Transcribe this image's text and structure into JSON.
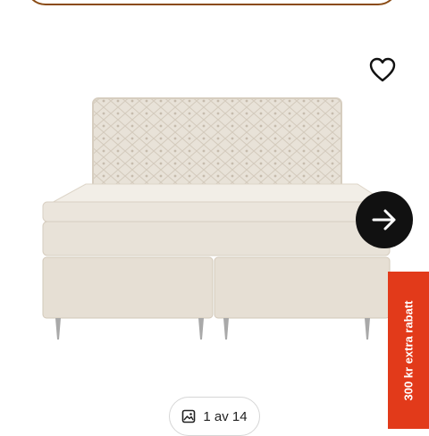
{
  "gallery": {
    "counter_text": "1 av 14",
    "icon_gallery": "image-gallery-icon"
  },
  "actions": {
    "favorite_icon": "heart-outline-icon",
    "next_icon": "arrow-right-icon"
  },
  "promo": {
    "label": "300 kr extra rabatt",
    "color": "#e23a1a"
  },
  "colors": {
    "top_pill_border": "#8a4b14",
    "next_button_bg": "#111111"
  }
}
